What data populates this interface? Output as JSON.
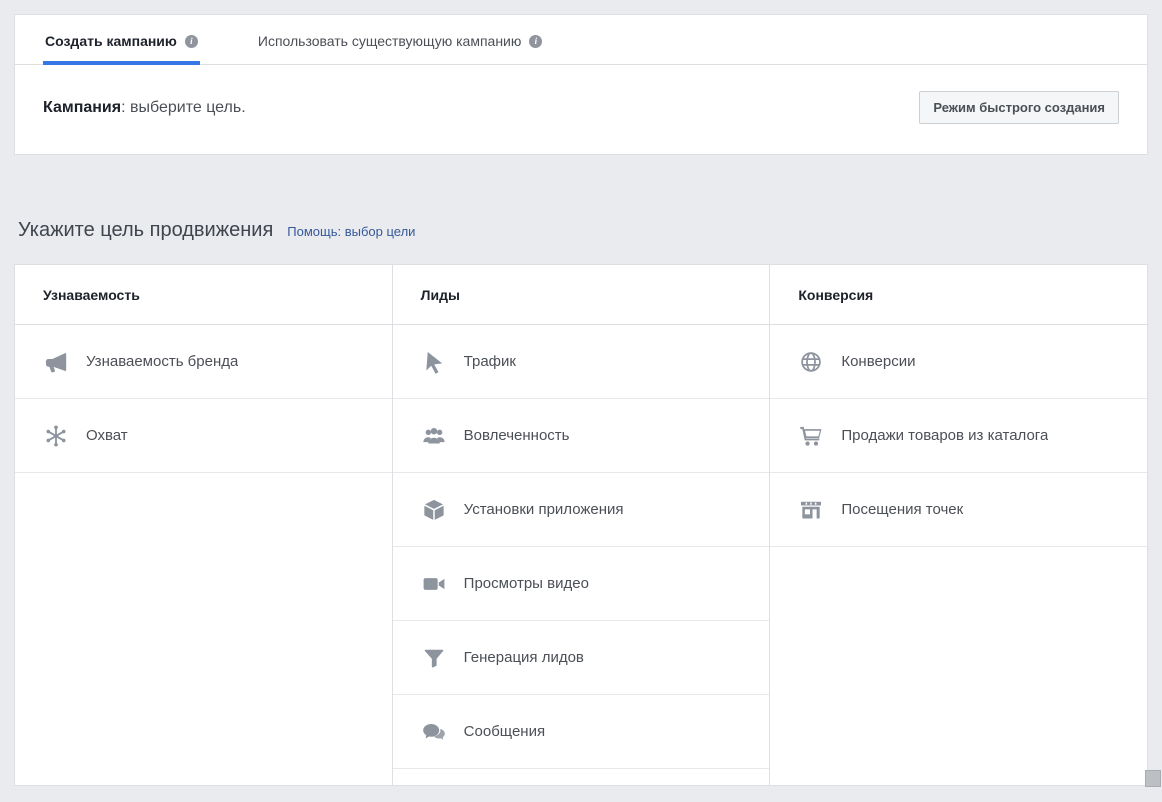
{
  "tabs": {
    "create": {
      "label": "Создать кампанию"
    },
    "existing": {
      "label": "Использовать существующую кампанию"
    }
  },
  "campaign": {
    "label_bold": "Кампания",
    "label_rest": ": выберите цель.",
    "quick_mode_button": "Режим быстрого создания"
  },
  "objective": {
    "title": "Укажите цель продвижения",
    "help_link": "Помощь: выбор цели",
    "columns": [
      {
        "header": "Узнаваемость",
        "items": [
          {
            "label": "Узнаваемость бренда",
            "icon": "megaphone-icon"
          },
          {
            "label": "Охват",
            "icon": "reach-burst-icon"
          }
        ]
      },
      {
        "header": "Лиды",
        "items": [
          {
            "label": "Трафик",
            "icon": "cursor-icon"
          },
          {
            "label": "Вовлеченность",
            "icon": "people-icon"
          },
          {
            "label": "Установки приложения",
            "icon": "app-cube-icon"
          },
          {
            "label": "Просмотры видео",
            "icon": "video-camera-icon"
          },
          {
            "label": "Генерация лидов",
            "icon": "funnel-icon"
          },
          {
            "label": "Сообщения",
            "icon": "chat-bubbles-icon"
          }
        ]
      },
      {
        "header": "Конверсия",
        "items": [
          {
            "label": "Конверсии",
            "icon": "globe-icon"
          },
          {
            "label": "Продажи товаров из каталога",
            "icon": "cart-icon"
          },
          {
            "label": "Посещения точек",
            "icon": "storefront-icon"
          }
        ]
      }
    ]
  },
  "colors": {
    "accent": "#3578e5",
    "link": "#365899",
    "icon_gray": "#8d949e",
    "page_bg": "#e9ebee"
  }
}
